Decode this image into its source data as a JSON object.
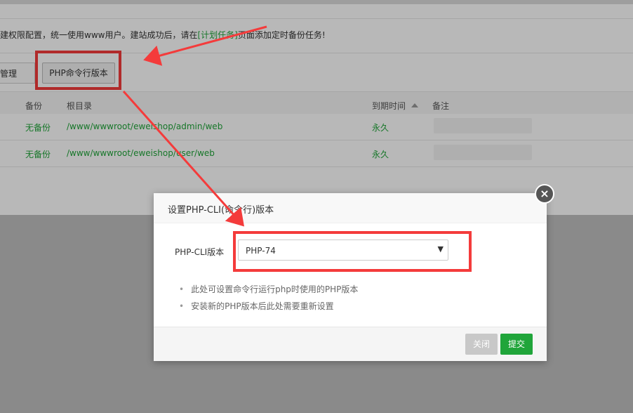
{
  "notice": {
    "pre": "建权限配置，统一使用www用户。建站成功后，请在",
    "link": "[计划任务]",
    "post": "页面添加定时备份任务!"
  },
  "toolbar": {
    "category_label": "分类管理",
    "php_cli_label": "PHP命令行版本"
  },
  "table": {
    "headers": {
      "backup": "备份",
      "root": "根目录",
      "expire": "到期时间",
      "note": "备注"
    },
    "rows": [
      {
        "backup": "无备份",
        "root": "/www/wwwroot/eweishop/admin/web",
        "expire": "永久"
      },
      {
        "backup": "无备份",
        "root": "/www/wwwroot/eweishop/user/web",
        "expire": "永久"
      }
    ]
  },
  "modal": {
    "title": "设置PHP-CLI(命令行)版本",
    "field_label": "PHP-CLI版本",
    "selected": "PHP-74",
    "tips": [
      "此处可设置命令行运行php时使用的PHP版本",
      "安装新的PHP版本后此处需要重新设置"
    ],
    "close_label": "关闭",
    "submit_label": "提交"
  },
  "colors": {
    "accent": "#20a53a",
    "highlight": "#f43b3b",
    "link": "#20a53a"
  }
}
